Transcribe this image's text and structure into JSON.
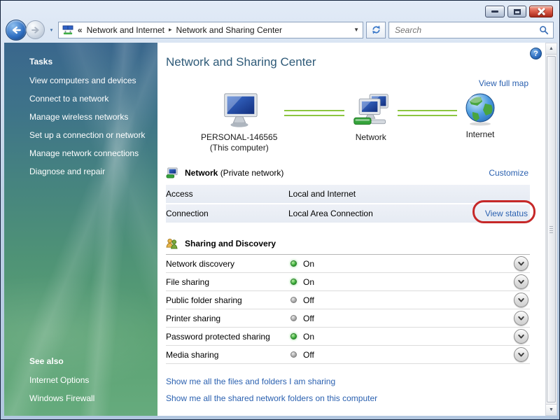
{
  "chrome": {
    "search_placeholder": "Search"
  },
  "icons": {
    "overflow_chevrons": "«",
    "crumb_separator": "▸",
    "breadcrumb_dropdown": "▼",
    "nav_dropdown": "▼",
    "help": "?",
    "scroll_up": "▲",
    "scroll_down": "▼"
  },
  "breadcrumb": [
    "Network and Internet",
    "Network and Sharing Center"
  ],
  "sidebar": {
    "tasks_header": "Tasks",
    "tasks": [
      "View computers and devices",
      "Connect to a network",
      "Manage wireless networks",
      "Set up a connection or network",
      "Manage network connections",
      "Diagnose and repair"
    ],
    "see_also_header": "See also",
    "see_also": [
      "Internet Options",
      "Windows Firewall"
    ]
  },
  "main": {
    "title": "Network and Sharing Center",
    "view_full_map_link": "View full map",
    "map": {
      "computer_label": "PERSONAL-146565",
      "computer_sublabel": "(This computer)",
      "network_label": "Network",
      "internet_label": "Internet"
    },
    "network_section": {
      "name": "Network",
      "kind": "(Private network)",
      "customize_link": "Customize",
      "rows": [
        {
          "label": "Access",
          "value": "Local and Internet"
        },
        {
          "label": "Connection",
          "value": "Local Area Connection",
          "action": "View status"
        }
      ]
    },
    "sharing_section": {
      "header": "Sharing and Discovery",
      "rows": [
        {
          "label": "Network discovery",
          "status": "On"
        },
        {
          "label": "File sharing",
          "status": "On"
        },
        {
          "label": "Public folder sharing",
          "status": "Off"
        },
        {
          "label": "Printer sharing",
          "status": "Off"
        },
        {
          "label": "Password protected sharing",
          "status": "On"
        },
        {
          "label": "Media sharing",
          "status": "Off"
        }
      ],
      "links": [
        "Show me all the files and folders I am sharing",
        "Show me all the shared network folders on this computer"
      ]
    }
  },
  "colors": {
    "link": "#2b61b0",
    "heading": "#2e5a78",
    "annotation_red": "#c62828",
    "map_line_green": "#8cc63f",
    "status_on": "#2fa52f",
    "status_off": "#9b9b9b"
  }
}
